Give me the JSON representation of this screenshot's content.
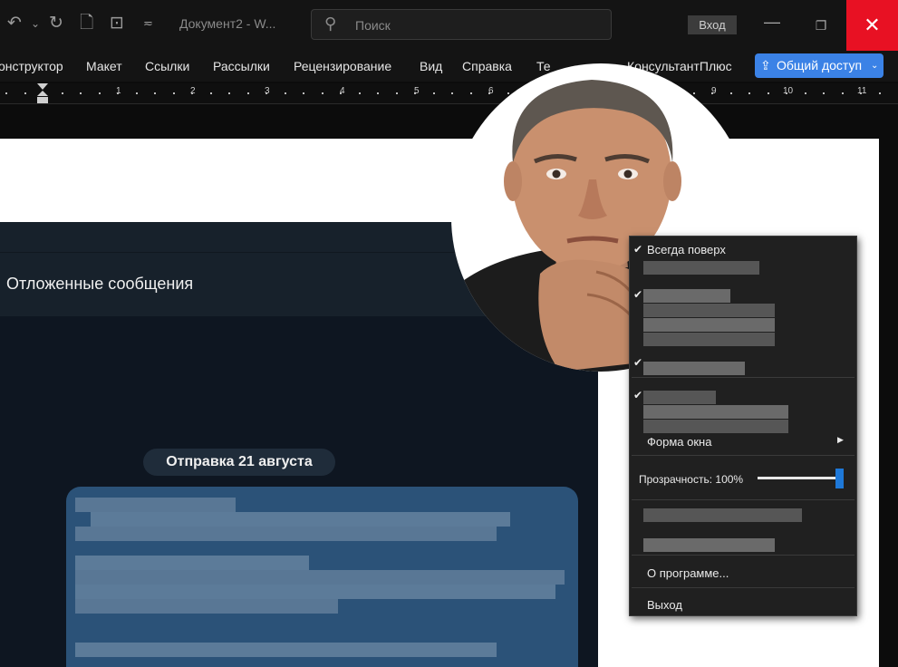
{
  "window": {
    "doc_title": "Документ2  -  W...",
    "search_placeholder": "Поиск",
    "signin_label": "Вход",
    "minimize_glyph": "—",
    "restore_glyph": "❐",
    "close_glyph": "✕"
  },
  "quick_access": {
    "undo_glyph": "↶",
    "undo_more_glyph": "⌄",
    "redo_glyph": "↻",
    "new_glyph": "🗋",
    "pics_glyph": "⊡",
    "customize_glyph": "≂"
  },
  "ribbon": {
    "tabs": [
      "онструктор",
      "Макет",
      "Ссылки",
      "Рассылки",
      "Рецензирование",
      "Вид",
      "Справка",
      "Те",
      "КонсультантПлюс"
    ],
    "share_label": "Общий доступ",
    "share_glyph": "⇪",
    "share_chevron": "⌄"
  },
  "ruler": {
    "numbers": [
      "1",
      "2",
      "3",
      "4",
      "5",
      "6",
      "9",
      "10",
      "11"
    ]
  },
  "telegram": {
    "minimize_glyph": "—",
    "header_title": "Отложенные сообщения",
    "date_label": "Отправка 21 августа"
  },
  "context_menu": {
    "always_on_top": "Всегда поверх",
    "window_shape": "Форма окна",
    "submenu_arrow": "▶",
    "transparency_label": "Прозрачность: 100%",
    "transparency_value": 100,
    "about": "О программе...",
    "exit": "Выход",
    "check_glyph": "✔"
  },
  "colors": {
    "close_red": "#e81123",
    "share_blue": "#3b82e6",
    "bubble_blue": "#2b5278",
    "slider_blue": "#1e78d8"
  }
}
